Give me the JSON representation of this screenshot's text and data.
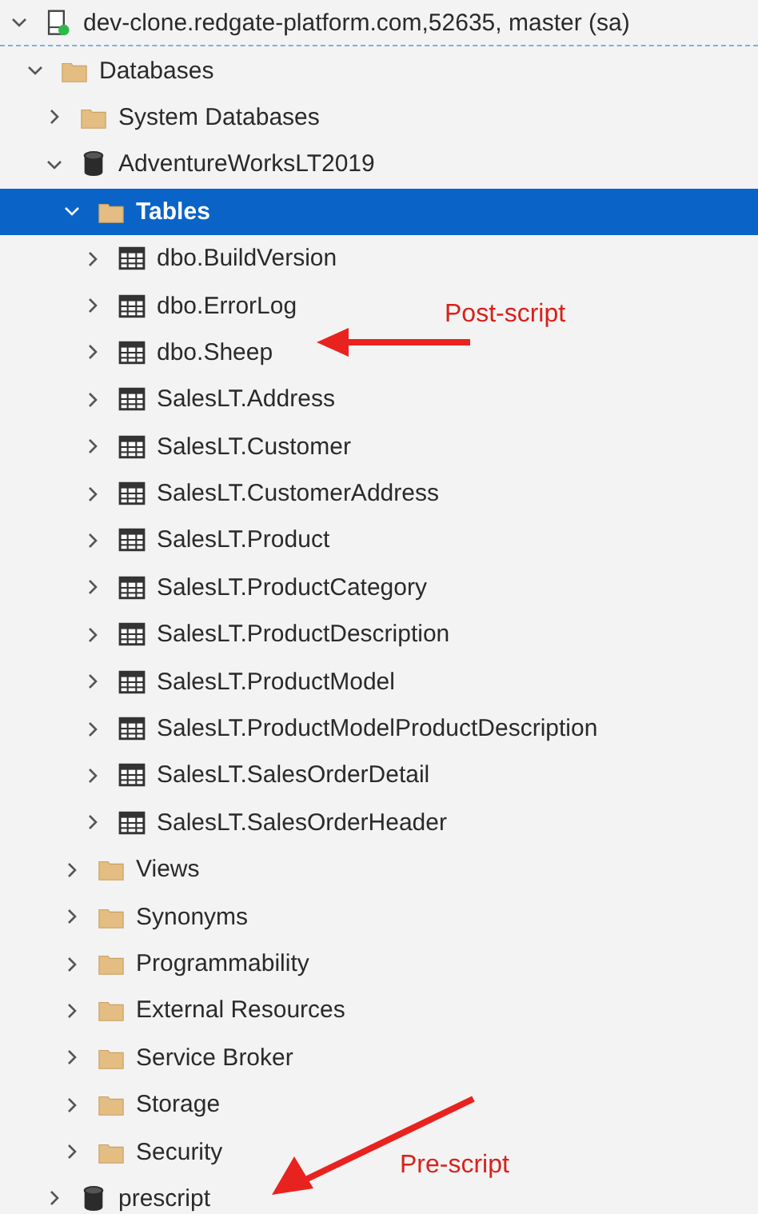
{
  "tree": [
    {
      "label": "dev-clone.redgate-platform.com,52635, master (sa)",
      "kind": "server",
      "connected": true,
      "expanded": true,
      "selected": false,
      "children": [
        {
          "label": "Databases",
          "kind": "folder",
          "expanded": true,
          "selected": false,
          "children": [
            {
              "label": "System Databases",
              "kind": "folder",
              "expanded": false,
              "selected": false
            },
            {
              "label": "AdventureWorksLT2019",
              "kind": "database",
              "expanded": true,
              "selected": false,
              "children": [
                {
                  "label": "Tables",
                  "kind": "folder",
                  "expanded": true,
                  "selected": true,
                  "children": [
                    {
                      "label": "dbo.BuildVersion",
                      "kind": "table",
                      "expanded": false,
                      "selected": false
                    },
                    {
                      "label": "dbo.ErrorLog",
                      "kind": "table",
                      "expanded": false,
                      "selected": false
                    },
                    {
                      "label": "dbo.Sheep",
                      "kind": "table",
                      "expanded": false,
                      "selected": false
                    },
                    {
                      "label": "SalesLT.Address",
                      "kind": "table",
                      "expanded": false,
                      "selected": false
                    },
                    {
                      "label": "SalesLT.Customer",
                      "kind": "table",
                      "expanded": false,
                      "selected": false
                    },
                    {
                      "label": "SalesLT.CustomerAddress",
                      "kind": "table",
                      "expanded": false,
                      "selected": false
                    },
                    {
                      "label": "SalesLT.Product",
                      "kind": "table",
                      "expanded": false,
                      "selected": false
                    },
                    {
                      "label": "SalesLT.ProductCategory",
                      "kind": "table",
                      "expanded": false,
                      "selected": false
                    },
                    {
                      "label": "SalesLT.ProductDescription",
                      "kind": "table",
                      "expanded": false,
                      "selected": false
                    },
                    {
                      "label": "SalesLT.ProductModel",
                      "kind": "table",
                      "expanded": false,
                      "selected": false
                    },
                    {
                      "label": "SalesLT.ProductModelProductDescription",
                      "kind": "table",
                      "expanded": false,
                      "selected": false
                    },
                    {
                      "label": "SalesLT.SalesOrderDetail",
                      "kind": "table",
                      "expanded": false,
                      "selected": false
                    },
                    {
                      "label": "SalesLT.SalesOrderHeader",
                      "kind": "table",
                      "expanded": false,
                      "selected": false
                    }
                  ]
                },
                {
                  "label": "Views",
                  "kind": "folder",
                  "expanded": false,
                  "selected": false
                },
                {
                  "label": "Synonyms",
                  "kind": "folder",
                  "expanded": false,
                  "selected": false
                },
                {
                  "label": "Programmability",
                  "kind": "folder",
                  "expanded": false,
                  "selected": false
                },
                {
                  "label": "External Resources",
                  "kind": "folder",
                  "expanded": false,
                  "selected": false
                },
                {
                  "label": "Service Broker",
                  "kind": "folder",
                  "expanded": false,
                  "selected": false
                },
                {
                  "label": "Storage",
                  "kind": "folder",
                  "expanded": false,
                  "selected": false
                },
                {
                  "label": "Security",
                  "kind": "folder",
                  "expanded": false,
                  "selected": false
                }
              ]
            },
            {
              "label": "prescript",
              "kind": "database",
              "expanded": false,
              "selected": false
            }
          ]
        }
      ]
    }
  ],
  "annotations": [
    {
      "text": "Post-script"
    },
    {
      "text": "Pre-script"
    }
  ]
}
